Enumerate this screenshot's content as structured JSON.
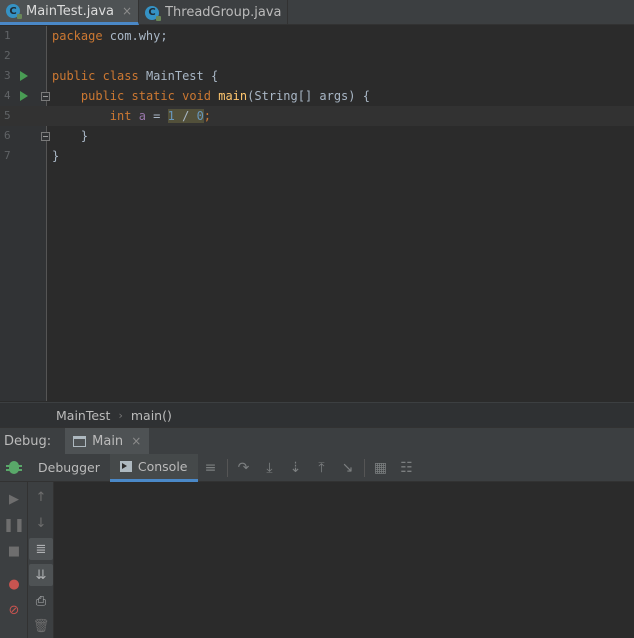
{
  "tabs": [
    {
      "label": "MainTest.java",
      "close": "×",
      "active": true
    },
    {
      "label": "ThreadGroup.java",
      "close": "×",
      "active": false
    }
  ],
  "editor": {
    "line_numbers": [
      "1",
      "2",
      "3",
      "4",
      "5",
      "6",
      "7"
    ],
    "line1": {
      "kw": "package",
      "rest": " com.why;"
    },
    "line3": {
      "kw1": "public",
      "kw2": "class",
      "rest": " MainTest {"
    },
    "line4": {
      "kw1": "public",
      "kw2": "static",
      "kw3": "void",
      "fn": "main",
      "rest": "(String[] args) {"
    },
    "line5": {
      "kw": "int",
      "var": "a",
      "eq": " = ",
      "num1": "1",
      "div": " / ",
      "num2": "0",
      "semi": ";"
    },
    "line6": {
      "text": "}"
    },
    "line7": {
      "text": "}"
    }
  },
  "breadcrumb": {
    "class_name": "MainTest",
    "separator": "›",
    "method": "main()"
  },
  "debug": {
    "title": "Debug:",
    "session_tab": "Main",
    "session_close": "×",
    "tabs": {
      "debugger": "Debugger",
      "console": "Console"
    }
  },
  "icons": {
    "toolbar": [
      "menu-icon",
      "step-over-icon",
      "step-into-icon",
      "force-step-into-icon",
      "step-out-icon",
      "run-to-cursor-icon",
      "evaluate-icon",
      "trace-icon"
    ],
    "left_strip": [
      "resume-icon",
      "pause-icon",
      "stop-icon",
      "view-breakpoints-icon",
      "mute-breakpoints-icon"
    ],
    "console_strip": [
      "up-icon",
      "down-icon",
      "soft-wrap-icon",
      "scroll-to-end-icon",
      "print-icon",
      "clear-icon"
    ]
  },
  "colors": {
    "keyword": "#cc7832",
    "function": "#ffc66d",
    "number": "#6897bb",
    "variable": "#9876aa",
    "run_green": "#499c54",
    "accent": "#4a88c7"
  }
}
